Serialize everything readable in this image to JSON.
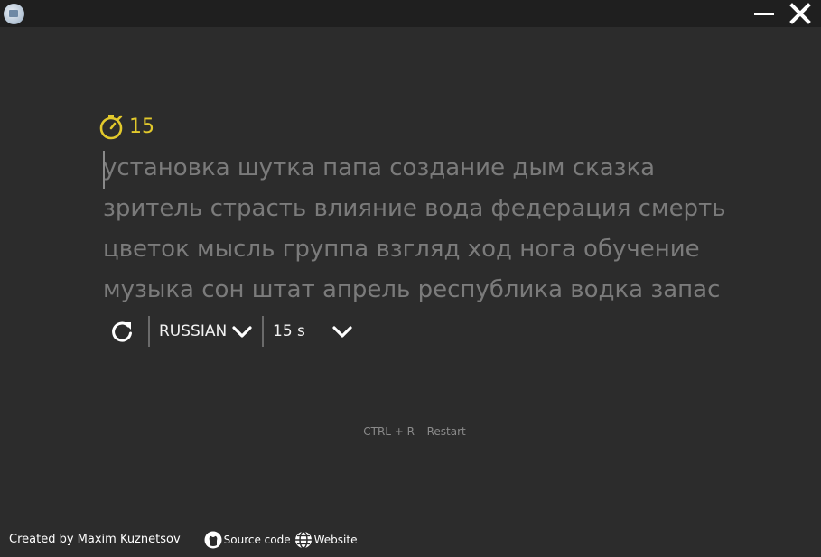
{
  "window": {
    "icon": "app-icon",
    "minimize_icon": "minimize-icon",
    "close_icon": "close-icon"
  },
  "timer": {
    "icon": "stopwatch-icon",
    "value": "15",
    "color": "#e2c92c"
  },
  "words": {
    "lines": [
      "установка шутка папа создание дым сказка",
      "зритель страсть влияние вода федерация смерть",
      "цветок мысль группа взгляд ход нога обучение",
      "музыка сон штат апрель республика водка запас"
    ],
    "color": "#7b7b7b"
  },
  "controls": {
    "restart_icon": "restart-icon",
    "language": "RUSSIAN",
    "duration": "15 s",
    "chevron_icon": "chevron-down-icon"
  },
  "hint": "CTRL + R – Restart",
  "footer": {
    "credit": "Created by Maxim Kuznetsov",
    "source_label": "Source code",
    "source_icon": "github-icon",
    "website_label": "Website",
    "website_icon": "globe-icon"
  },
  "colors": {
    "background": "#2c2c2c",
    "titlebar": "#1f1f1f",
    "accent": "#e2c92c"
  }
}
